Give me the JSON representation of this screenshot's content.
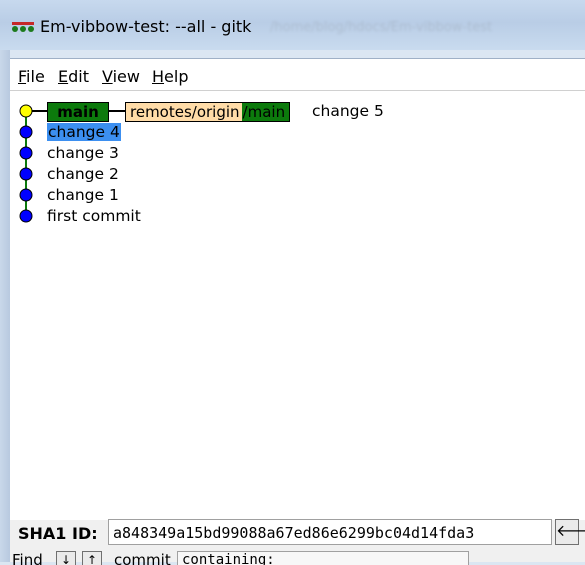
{
  "window": {
    "title": "Em-vibbow-test: --all - gitk",
    "blurred_path": "/home/blog/hdocs/Em-vibbow-test"
  },
  "menu": [
    {
      "label": "File",
      "mnemonic": "F",
      "rest": "ile"
    },
    {
      "label": "Edit",
      "mnemonic": "E",
      "rest": "dit"
    },
    {
      "label": "View",
      "mnemonic": "V",
      "rest": "iew"
    },
    {
      "label": "Help",
      "mnemonic": "H",
      "rest": "elp"
    }
  ],
  "commits": [
    {
      "label": "change 5",
      "tag_main": "main",
      "tag_remote_pre": "remotes/origin",
      "tag_remote_post": "/main"
    },
    {
      "label": "change 4",
      "selected": true
    },
    {
      "label": "change 3"
    },
    {
      "label": "change 2"
    },
    {
      "label": "change 1"
    },
    {
      "label": "first commit"
    }
  ],
  "sha": {
    "label": "SHA1 ID:",
    "value": "a848349a15bd99088a67ed86e6299bc04d14fda3",
    "back_glyph": "🡐"
  },
  "find": {
    "label": "Find",
    "down_glyph": "↓",
    "up_glyph": "↑",
    "commit_label": "commit",
    "containing": "containing:"
  },
  "colors": {
    "head_node": "#ffff00",
    "commit_node": "#0000ff",
    "branch_line": "#0c7a0c",
    "tag_green": "#0c7a0c",
    "tag_remote": "#ffdca8",
    "selection": "#3c8ff0"
  }
}
